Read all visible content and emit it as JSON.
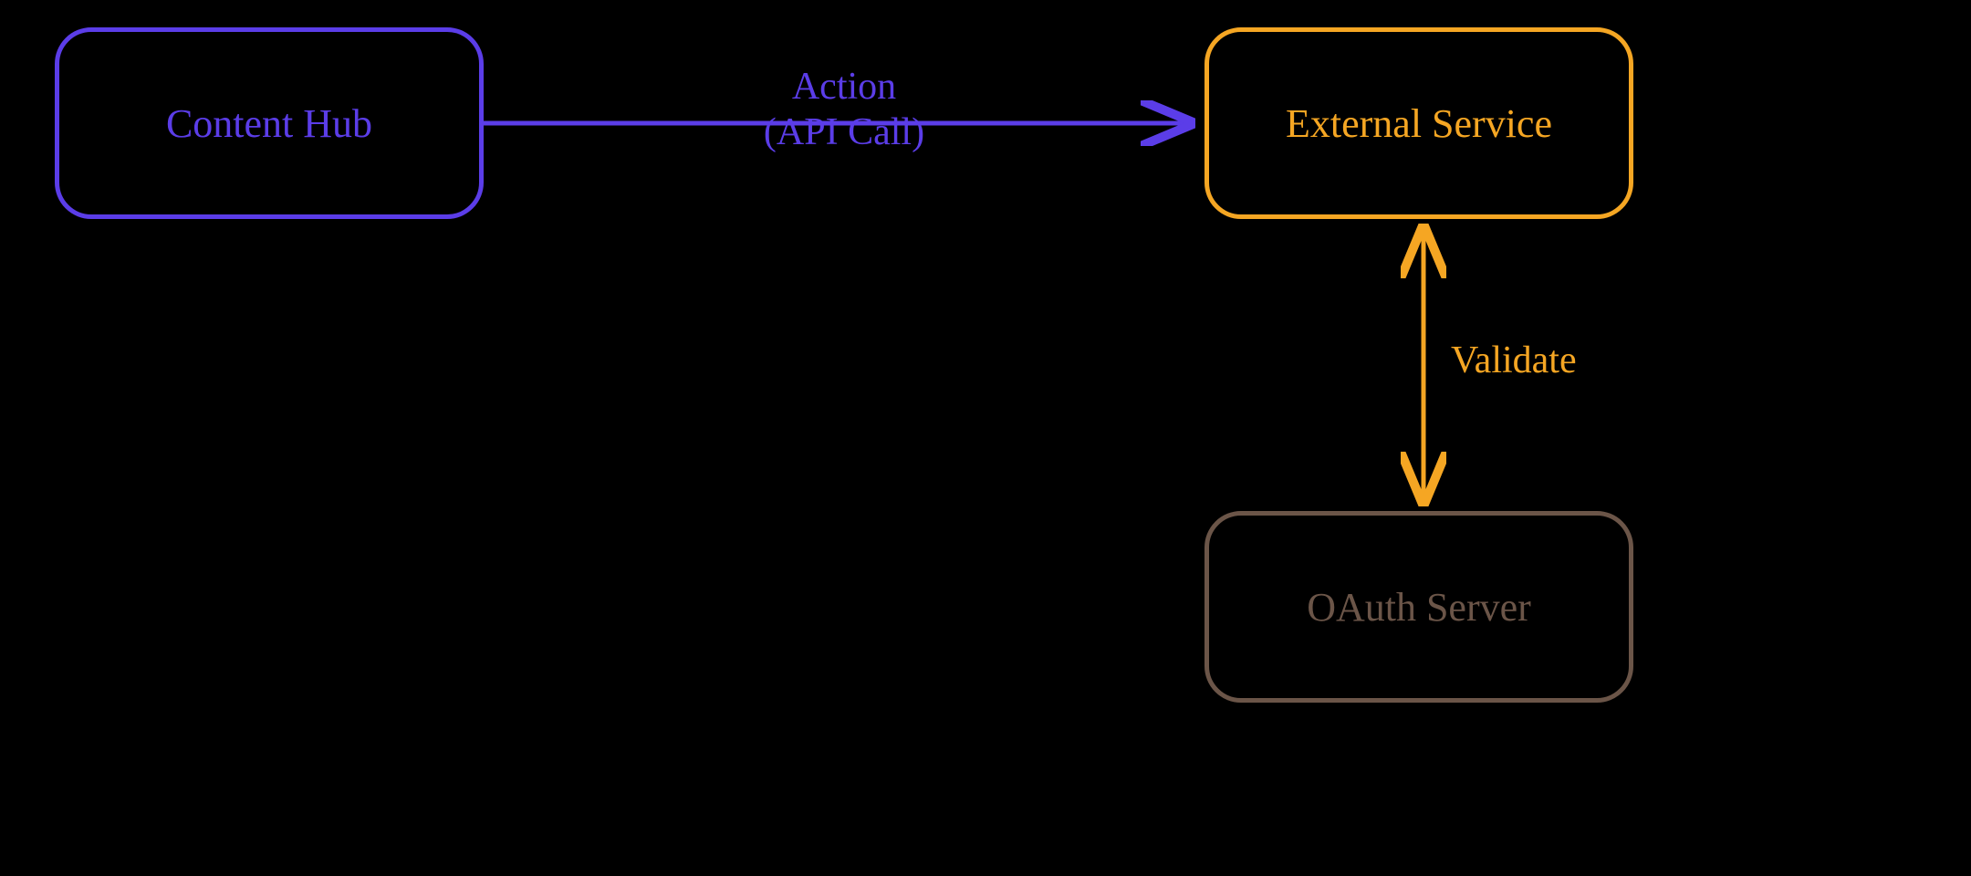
{
  "nodes": {
    "content_hub": {
      "label": "Content Hub",
      "color": "#5B3DE8"
    },
    "external_service": {
      "label": "External Service",
      "color": "#F5A623"
    },
    "oauth_server": {
      "label": "OAuth Server",
      "color": "#6B5548"
    }
  },
  "edges": {
    "action": {
      "label_line1": "Action",
      "label_line2": "(API Call)",
      "from": "content_hub",
      "to": "external_service",
      "color": "#5B3DE8"
    },
    "validate": {
      "label": "Validate",
      "from": "external_service",
      "to": "oauth_server",
      "bidirectional": true,
      "color": "#F5A623"
    }
  }
}
